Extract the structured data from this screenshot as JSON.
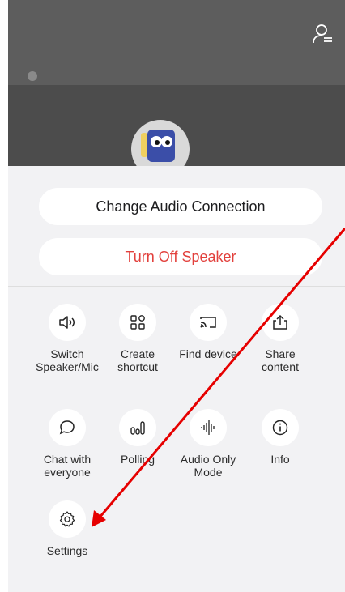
{
  "actions": {
    "change_audio": "Change Audio Connection",
    "turn_off_speaker": "Turn Off Speaker"
  },
  "tiles": [
    {
      "label": "Switch\nSpeaker/Mic",
      "icon": "speaker-icon"
    },
    {
      "label": "Create\nshortcut",
      "icon": "shortcut-grid-icon"
    },
    {
      "label": "Find device",
      "icon": "cast-icon"
    },
    {
      "label": "Share\ncontent",
      "icon": "share-upload-icon"
    },
    {
      "label": "Chat with\neveryone",
      "icon": "chat-bubble-icon"
    },
    {
      "label": "Polling",
      "icon": "polling-icon"
    },
    {
      "label": "Audio Only\nMode",
      "icon": "audio-wave-icon"
    },
    {
      "label": "Info",
      "icon": "info-icon"
    },
    {
      "label": "Settings",
      "icon": "gear-icon"
    }
  ],
  "colors": {
    "danger": "#e2403c",
    "annotation_arrow": "#e60000"
  }
}
